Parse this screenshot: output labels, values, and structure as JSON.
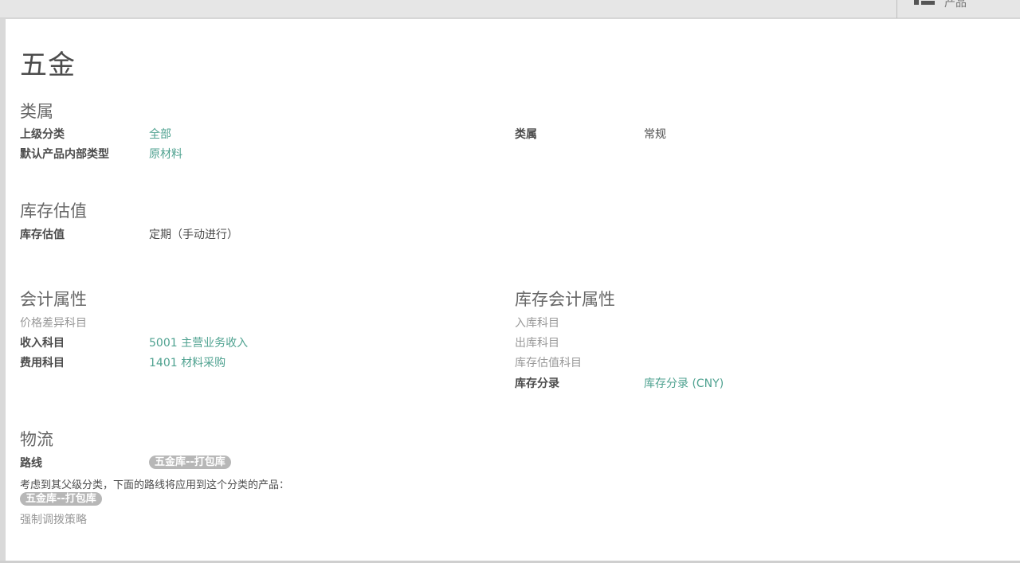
{
  "topbar": {
    "view_switch_label": "产品"
  },
  "title": "五金",
  "section_category": {
    "title": "类属",
    "parent_label": "上级分类",
    "parent_value": "全部",
    "default_type_label": "默认产品内部类型",
    "default_type_value": "原材料",
    "kind_label": "类属",
    "kind_value": "常规"
  },
  "section_valuation": {
    "title": "库存估值",
    "valuation_label": "库存估值",
    "valuation_value": "定期（手动进行）"
  },
  "section_accounting": {
    "title": "会计属性",
    "price_diff_label": "价格差异科目",
    "income_label": "收入科目",
    "income_value": "5001 主营业务收入",
    "expense_label": "费用科目",
    "expense_value": "1401 材料采购"
  },
  "section_stock_accounting": {
    "title": "库存会计属性",
    "input_label": "入库科目",
    "output_label": "出库科目",
    "valuation_account_label": "库存估值科目",
    "journal_label": "库存分录",
    "journal_value": "库存分录 (CNY)"
  },
  "section_logistics": {
    "title": "物流",
    "routes_label": "路线",
    "route_tag": "五金库--打包库",
    "inherit_note": "考虑到其父级分类，下面的路线将应用到这个分类的产品：",
    "inherited_route_tag": "五金库--打包库",
    "removal_label": "强制调拨策略"
  }
}
